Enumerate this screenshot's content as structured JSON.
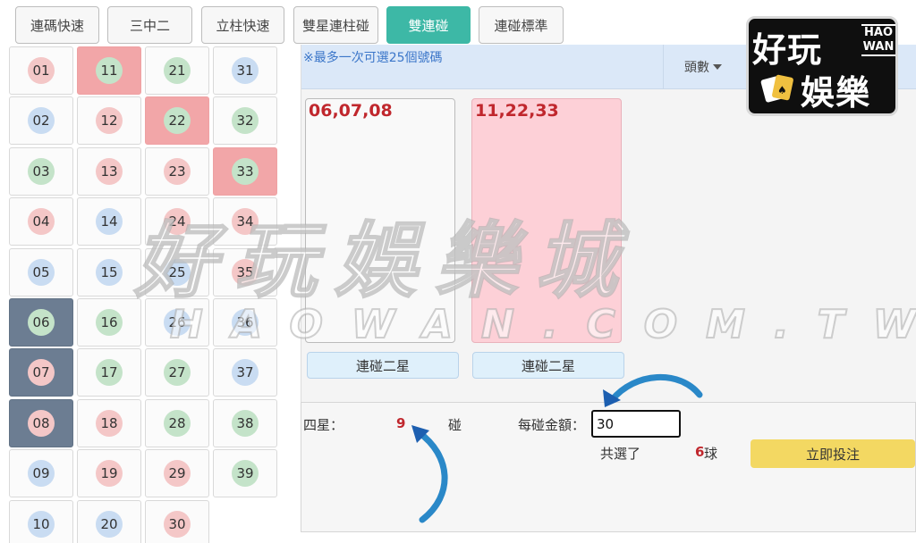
{
  "tabs": [
    {
      "label": "連碼快速",
      "active": false
    },
    {
      "label": "三中二",
      "active": false
    },
    {
      "label": "立柱快速",
      "active": false
    },
    {
      "label": "雙星連柱碰",
      "active": false
    },
    {
      "label": "雙連碰",
      "active": true
    },
    {
      "label": "連碰標準",
      "active": false
    }
  ],
  "numbers": [
    {
      "n": "01",
      "color": "red",
      "selected": ""
    },
    {
      "n": "02",
      "color": "blue",
      "selected": ""
    },
    {
      "n": "03",
      "color": "green",
      "selected": ""
    },
    {
      "n": "04",
      "color": "red",
      "selected": ""
    },
    {
      "n": "05",
      "color": "blue",
      "selected": ""
    },
    {
      "n": "06",
      "color": "green",
      "selected": "dark"
    },
    {
      "n": "07",
      "color": "red",
      "selected": "dark"
    },
    {
      "n": "08",
      "color": "red",
      "selected": "dark"
    },
    {
      "n": "09",
      "color": "blue",
      "selected": ""
    },
    {
      "n": "10",
      "color": "blue",
      "selected": ""
    },
    {
      "n": "11",
      "color": "green",
      "selected": "red"
    },
    {
      "n": "12",
      "color": "red",
      "selected": ""
    },
    {
      "n": "13",
      "color": "red",
      "selected": ""
    },
    {
      "n": "14",
      "color": "blue",
      "selected": ""
    },
    {
      "n": "15",
      "color": "blue",
      "selected": ""
    },
    {
      "n": "16",
      "color": "green",
      "selected": ""
    },
    {
      "n": "17",
      "color": "green",
      "selected": ""
    },
    {
      "n": "18",
      "color": "red",
      "selected": ""
    },
    {
      "n": "19",
      "color": "red",
      "selected": ""
    },
    {
      "n": "20",
      "color": "blue",
      "selected": ""
    },
    {
      "n": "21",
      "color": "green",
      "selected": ""
    },
    {
      "n": "22",
      "color": "green",
      "selected": "red"
    },
    {
      "n": "23",
      "color": "red",
      "selected": ""
    },
    {
      "n": "24",
      "color": "red",
      "selected": ""
    },
    {
      "n": "25",
      "color": "blue",
      "selected": ""
    },
    {
      "n": "26",
      "color": "blue",
      "selected": ""
    },
    {
      "n": "27",
      "color": "green",
      "selected": ""
    },
    {
      "n": "28",
      "color": "green",
      "selected": ""
    },
    {
      "n": "29",
      "color": "red",
      "selected": ""
    },
    {
      "n": "30",
      "color": "red",
      "selected": ""
    },
    {
      "n": "31",
      "color": "blue",
      "selected": ""
    },
    {
      "n": "32",
      "color": "green",
      "selected": ""
    },
    {
      "n": "33",
      "color": "green",
      "selected": "red"
    },
    {
      "n": "34",
      "color": "red",
      "selected": ""
    },
    {
      "n": "35",
      "color": "red",
      "selected": ""
    },
    {
      "n": "36",
      "color": "blue",
      "selected": ""
    },
    {
      "n": "37",
      "color": "blue",
      "selected": ""
    },
    {
      "n": "38",
      "color": "green",
      "selected": ""
    },
    {
      "n": "39",
      "color": "green",
      "selected": ""
    }
  ],
  "notice": "※最多一次可選25個號碼",
  "sort_label": "頭數",
  "combos": [
    {
      "numbers": "06,07,08",
      "button_label": "連碰二星"
    },
    {
      "numbers": "11,22,33",
      "button_label": "連碰二星"
    }
  ],
  "bottom": {
    "four_star_label": "四星：",
    "four_star_count": "9",
    "touch_label": "碰",
    "amount_label": "每碰金額：",
    "amount_value": "30",
    "total_label": "共選了",
    "total_count": "6",
    "balls_unit": "球",
    "submit_label": "立即投注"
  },
  "logo": {
    "title_top": "好玩",
    "title_bottom": "娛樂",
    "latin_top": "HAO",
    "latin_bottom": "WAN"
  },
  "watermark": {
    "main": "好玩娛樂城",
    "sub": "HAOWAN.COM.TW"
  },
  "colors": {
    "active_tab": "#3db8a6",
    "accent_red": "#c0272d",
    "submit": "#f3d862",
    "selected_dark": "#6c7d92",
    "selected_red": "#f2a6a8"
  }
}
